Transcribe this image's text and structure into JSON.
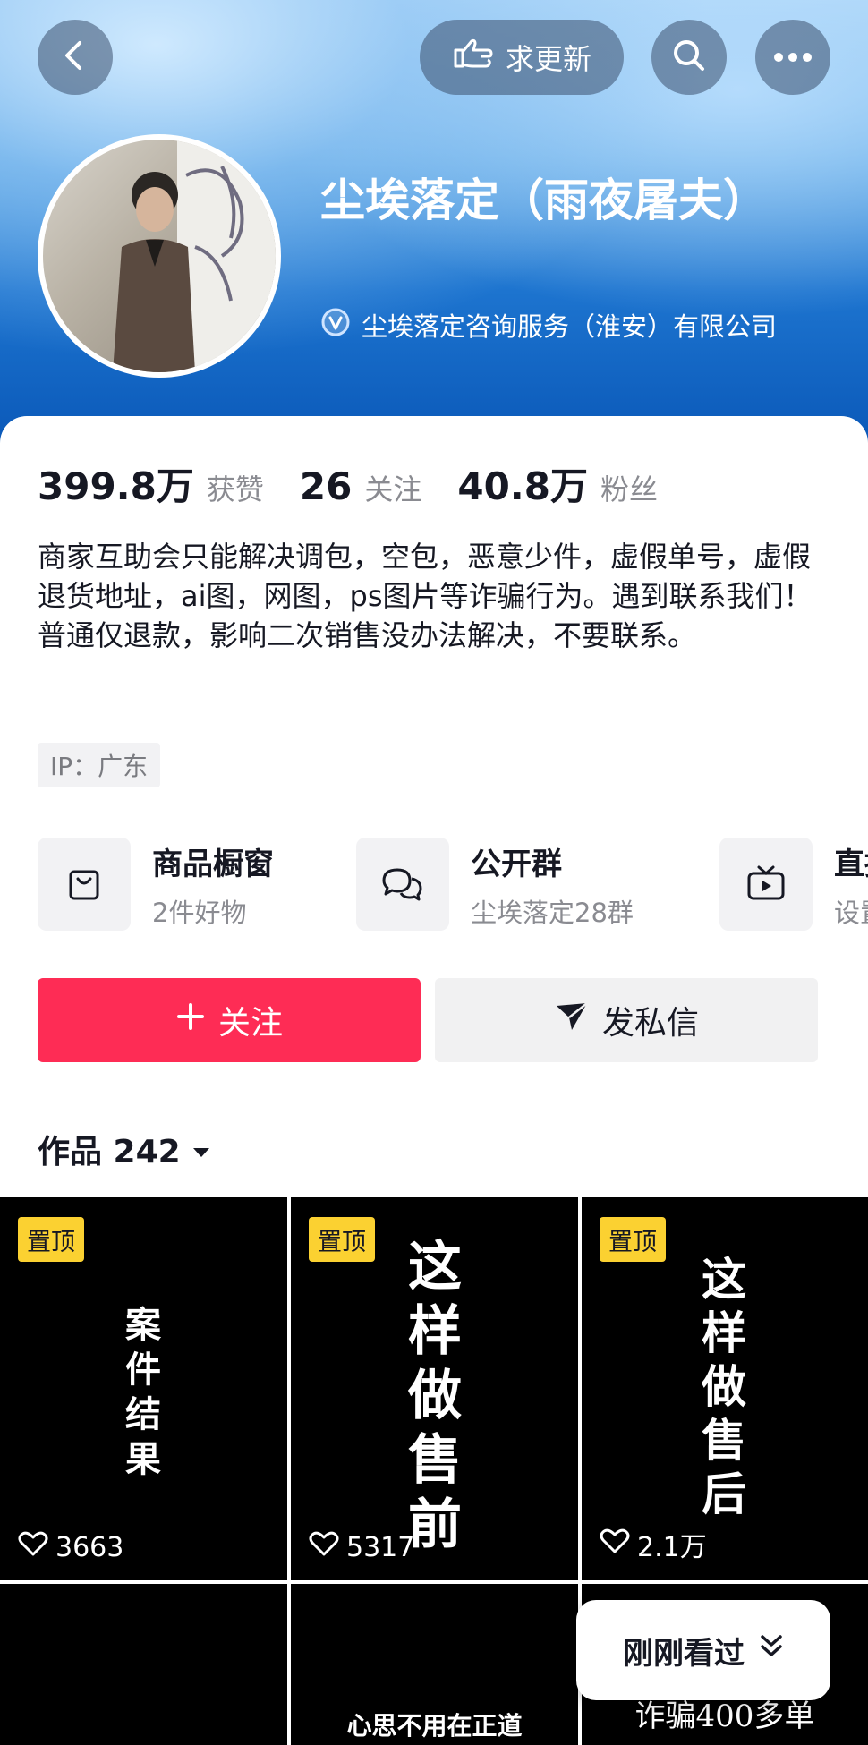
{
  "header": {
    "update_label": "求更新",
    "icons": {
      "back": "chevron-left-icon",
      "update": "hand-point-icon",
      "search": "search-icon",
      "more": "more-dots-icon"
    }
  },
  "profile": {
    "name": "尘埃落定（雨夜屠夫）",
    "verified_org": "尘埃落定咨询服务（淮安）有限公司",
    "stats": [
      {
        "value": "399.8万",
        "label": "获赞"
      },
      {
        "value": "26",
        "label": "关注"
      },
      {
        "value": "40.8万",
        "label": "粉丝"
      }
    ],
    "bio": "商家互助会只能解决调包，空包，恶意少件，虚假单号，虚假退货地址，ai图，网图，ps图片等诈骗行为。遇到联系我们！普通仅退款，影响二次销售没办法解决，不要联系。",
    "ip": "IP：广东"
  },
  "features": [
    {
      "title": "商品橱窗",
      "sub": "2件好物",
      "icon": "shopping-bag-icon"
    },
    {
      "title": "公开群",
      "sub": "尘埃落定28群",
      "icon": "group-chat-icon"
    },
    {
      "title": "直播",
      "sub": "设置",
      "icon": "tv-live-icon"
    }
  ],
  "actions": {
    "follow": "关注",
    "message": "发私信"
  },
  "works": {
    "label": "作品 242",
    "pinned_badge": "置顶",
    "tiles": [
      {
        "text": "案件结果",
        "likes": "3663",
        "pinned": true
      },
      {
        "text": "这样做售前",
        "likes": "5317",
        "pinned": true
      },
      {
        "text": "这样做售后",
        "likes": "2.1万",
        "pinned": true
      },
      {
        "text": "",
        "likes": "",
        "pinned": false
      },
      {
        "text": "心思不用在正道",
        "likes": "",
        "pinned": false
      },
      {
        "text": "诈骗400多单",
        "likes": "",
        "pinned": false
      }
    ]
  },
  "recently_viewed": "刚刚看过"
}
